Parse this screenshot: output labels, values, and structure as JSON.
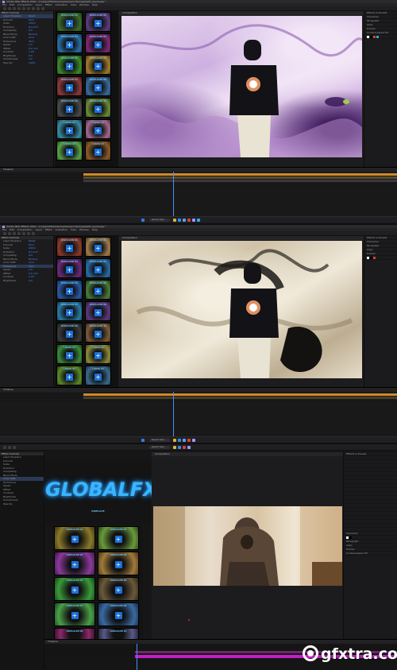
{
  "app": {
    "title": "Adobe After Effects 2022 - C:\\Users\\Ffx\\Downloads\\Liquid Pack\\globalfx_liquid.aep *",
    "menu": [
      "File",
      "Edit",
      "Composition",
      "Layer",
      "Effect",
      "Animation",
      "View",
      "Window",
      "Help"
    ]
  },
  "panels": {
    "effect_controls": "Effect Controls",
    "composition": "Composition",
    "timeline": "Timeline",
    "effects_presets": "Effects & Presets",
    "character": "Character",
    "paragraph": "Paragraph",
    "align": "Align",
    "tracker": "Tracker",
    "content_aware_fill": "Content-Aware Fill"
  },
  "effect_props": [
    {
      "label": "Liquid Displace",
      "value": "Reset"
    },
    {
      "label": "Amount",
      "value": "64.0"
    },
    {
      "label": "Scale",
      "value": "100.0"
    },
    {
      "label": "Evolution",
      "value": "0x+0.0°"
    },
    {
      "label": "Complexity",
      "value": "6.0"
    },
    {
      "label": "Blend Mode",
      "value": "Normal"
    },
    {
      "label": "Color Shift",
      "value": "12.0"
    },
    {
      "label": "Turbulence",
      "value": "40.0"
    },
    {
      "label": "Speed",
      "value": "1.0"
    },
    {
      "label": "Offset",
      "value": "0.0, 0.0"
    },
    {
      "label": "Contrast",
      "value": "1.20"
    },
    {
      "label": "Brightness",
      "value": "0.0"
    },
    {
      "label": "Smoothness",
      "value": "3.0"
    },
    {
      "label": "Opacity",
      "value": "100%"
    }
  ],
  "presets": [
    {
      "label": "DISPLACER 01"
    },
    {
      "label": "DISPLACER 02"
    },
    {
      "label": "DISPLACER 03"
    },
    {
      "label": "DISPLACER 04"
    },
    {
      "label": "DISPLACER 05"
    },
    {
      "label": "DISPLACER 06"
    },
    {
      "label": "DISPLACER 07"
    },
    {
      "label": "DISPLACER 08"
    },
    {
      "label": "DISPLACER 09"
    },
    {
      "label": "DISPLACER 10"
    },
    {
      "label": "LIQUID 01"
    },
    {
      "label": "LIQUID 02"
    },
    {
      "label": "LIQUID 03"
    },
    {
      "label": "LIQUID 04"
    }
  ],
  "logo": {
    "text": "GLOBALFX",
    "mark": "®",
    "sub": "DISPLACE"
  },
  "taskbar": {
    "search": "Search here"
  },
  "watermark": {
    "text": "gfxtra.com"
  },
  "colors": {
    "accent": "#4a8dff",
    "preset_label": "#6fc3ff",
    "timeline_orange": "#d0892c",
    "timeline_magenta": "#c41ec4"
  }
}
